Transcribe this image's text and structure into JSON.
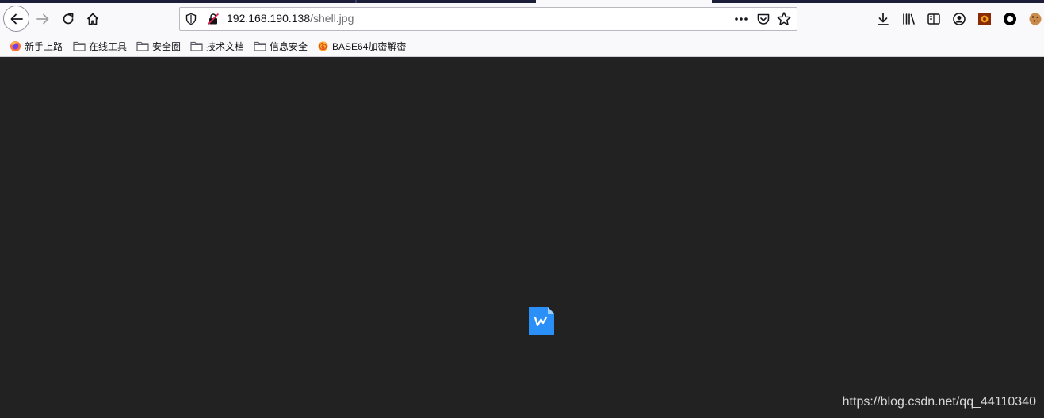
{
  "browser": {
    "url_host": "192.168.190.138",
    "url_path": "/shell.jpg",
    "toolbar_icons": [
      "back-icon",
      "forward-icon",
      "reload-icon",
      "home-icon",
      "tracking-shield-icon",
      "insecure-lock-icon",
      "page-actions-icon",
      "pocket-icon",
      "bookmark-star-icon",
      "download-icon",
      "library-icon",
      "sidebar-icon",
      "account-icon",
      "extension-icon",
      "extension-icon",
      "cookie-icon"
    ]
  },
  "bookmarks": [
    {
      "label": "新手上路",
      "icon": "firefox-icon"
    },
    {
      "label": "在线工具",
      "icon": "folder-icon"
    },
    {
      "label": "安全圈",
      "icon": "folder-icon"
    },
    {
      "label": "技术文档",
      "icon": "folder-icon"
    },
    {
      "label": "信息安全",
      "icon": "folder-icon"
    },
    {
      "label": "BASE64加密解密",
      "icon": "swirl-icon"
    }
  ],
  "content": {
    "broken_image_icon": "wps-document-icon",
    "watermark": "https://blog.csdn.net/qq_44110340"
  },
  "colors": {
    "content_bg": "#222222",
    "toolbar_bg": "#f9f9fb",
    "wps_blue": "#2a8ff7"
  }
}
